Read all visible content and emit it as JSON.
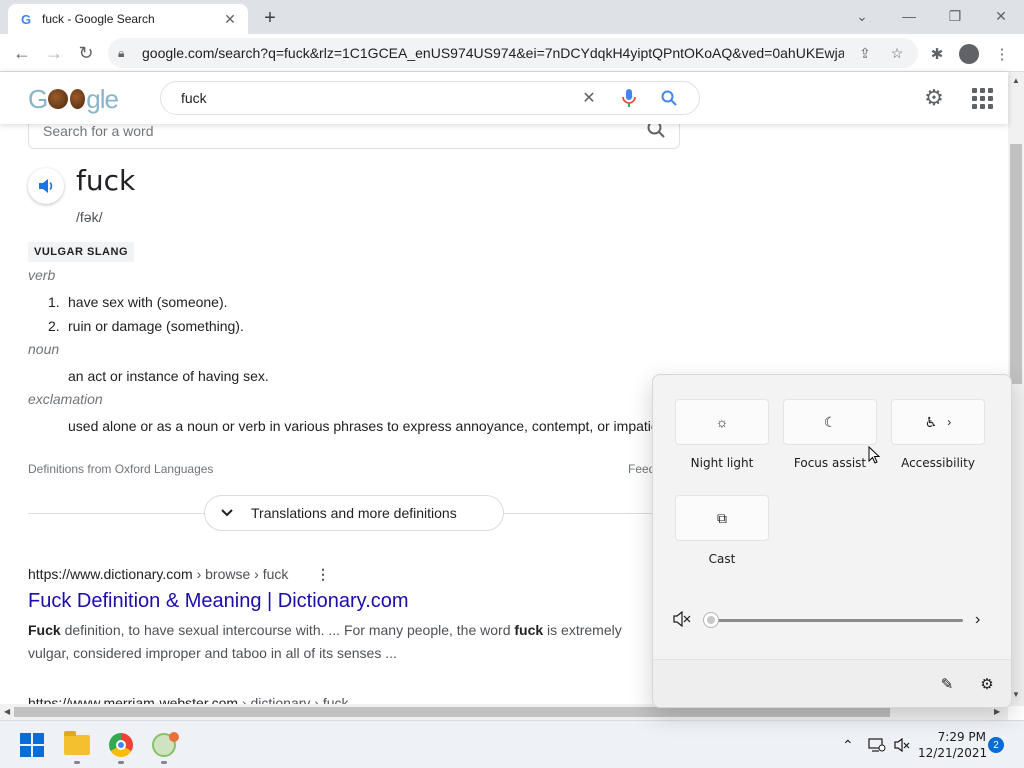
{
  "browser": {
    "tab_title": "fuck - Google Search",
    "favicon": "G",
    "url": "google.com/search?q=fuck&rlz=1C1GCEA_enUS974US974&ei=7nDCYdqkH4yiptQPntOKoAQ&ved=0ahUKEwja0...",
    "new_tab_label": "+",
    "window_controls": [
      "chevron-down-icon",
      "minimize-icon",
      "restore-icon",
      "close-icon"
    ]
  },
  "google": {
    "query": "fuck"
  },
  "dictionary": {
    "word_search_placeholder": "Search for a word",
    "word": "fuck",
    "phonetic": "/fək/",
    "register": "VULGAR SLANG",
    "senses": [
      {
        "pos": "verb",
        "definitions": [
          "have sex with (someone).",
          "ruin or damage (something)."
        ]
      },
      {
        "pos": "noun",
        "definitions": [
          "an act or instance of having sex."
        ]
      },
      {
        "pos": "exclamation",
        "definitions": [
          "used alone or as a noun or verb in various phrases to express annoyance, contempt, or impatie"
        ]
      }
    ],
    "numbering": [
      "1.",
      "2."
    ],
    "source": "Definitions from Oxford Languages",
    "feedback": "Feed",
    "more_button": "Translations and more definitions"
  },
  "results": [
    {
      "domain": "https://www.dictionary.com",
      "breadcrumb": " › browse › fuck",
      "title": "Fuck Definition & Meaning | Dictionary.com",
      "snippet_bold1": "Fuck",
      "snippet_1": " definition, to have sexual intercourse with. ... For many people, the word ",
      "snippet_bold2": "fuck",
      "snippet_2": " is extremely vulgar, considered improper and taboo in all of its senses ..."
    },
    {
      "domain": "https://www.merriam-webster.com",
      "breadcrumb": " › dictionary › fuck"
    }
  ],
  "quick_settings": {
    "tiles": [
      {
        "label": "Night light",
        "icon": "brightness-icon"
      },
      {
        "label": "Focus assist",
        "icon": "moon-icon"
      },
      {
        "label": "Accessibility",
        "icon": "accessibility-icon"
      },
      {
        "label": "Cast",
        "icon": "cast-icon"
      }
    ],
    "volume_level": 0,
    "muted": true
  },
  "taskbar": {
    "time": "7:29 PM",
    "date": "12/21/2021",
    "notification_count": "2"
  },
  "colors": {
    "link": "#1a0dab",
    "accent": "#1a73e8",
    "windows_blue": "#0a6cd6"
  }
}
